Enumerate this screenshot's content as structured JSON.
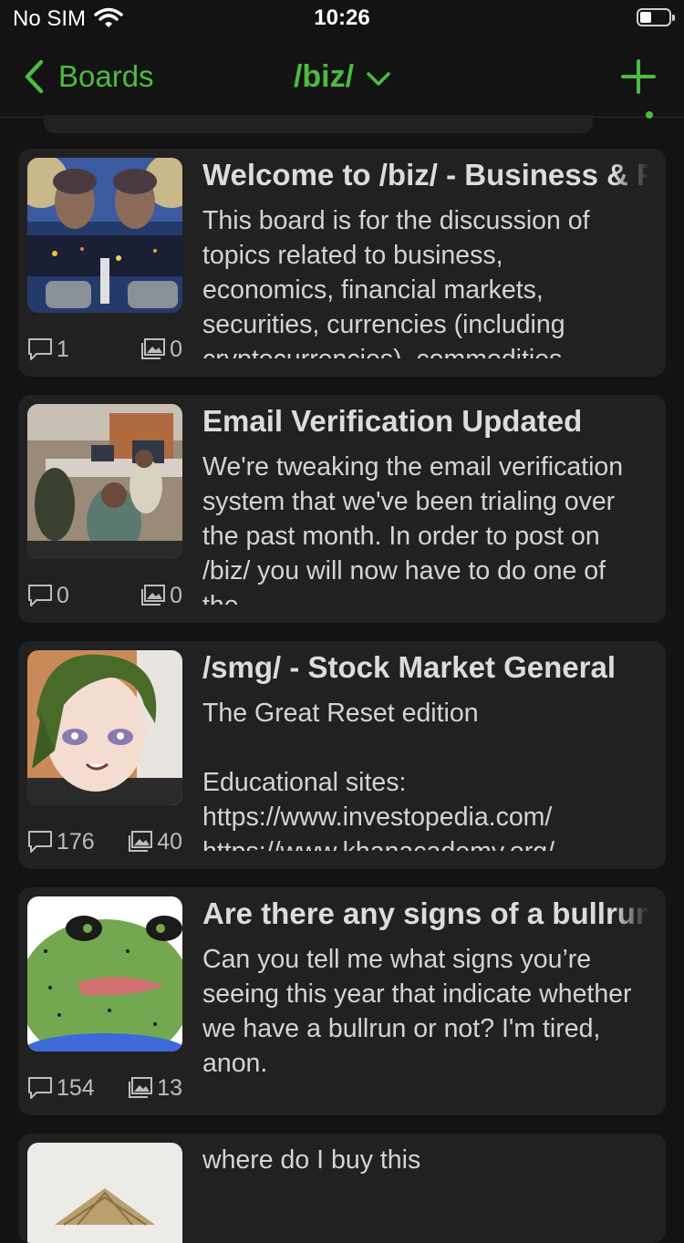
{
  "status_bar": {
    "carrier": "No SIM",
    "time": "10:26"
  },
  "nav": {
    "back_label": "Boards",
    "board_title": "/biz/"
  },
  "threads": [
    {
      "title": "Welcome to /biz/ - Business & Finance",
      "body": "This board is for the discussion of topics related to business, economics, financial markets, securities, currencies (including cryptocurrencies), commodities",
      "replies": "1",
      "images": "0"
    },
    {
      "title": "Email Verification Updated",
      "body": "We're tweaking the email verification system that we've been trialing over the past month. In order to post on /biz/ you will now have to do one of the",
      "replies": "0",
      "images": "0"
    },
    {
      "title": "/smg/ - Stock Market General",
      "body_lines": [
        "The Great Reset edition",
        "",
        "Educational sites:",
        "https://www.investopedia.com/",
        "https://www.khanacademy.org/"
      ],
      "replies": "176",
      "images": "40"
    },
    {
      "title": "Are there any signs of a bullrun?",
      "body": "Can you tell me what signs you’re seeing this year that indicate whether we have a bullrun or not? I'm tired, anon.",
      "replies": "154",
      "images": "13"
    },
    {
      "title": "",
      "body": "where do I buy this",
      "replies": "",
      "images": ""
    }
  ],
  "colors": {
    "accent": "#4cbc3f",
    "background": "#131313",
    "card": "#212121"
  }
}
